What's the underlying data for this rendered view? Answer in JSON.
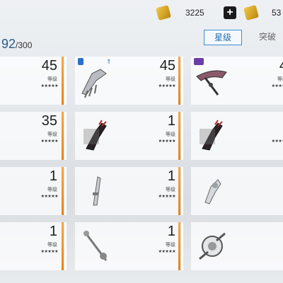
{
  "topbar": {
    "currency1_value": "3225",
    "currency2_value": "53",
    "plus_label": "+"
  },
  "inventory": {
    "count": "92",
    "capacity": "/300"
  },
  "tabs": {
    "active": "星级",
    "other": "突破"
  },
  "rows": [
    {
      "left_level": "45",
      "mid_level": "45",
      "right_level": "4"
    },
    {
      "left_level": "35",
      "mid_level": "1",
      "right_level": ""
    },
    {
      "left_level": "1",
      "mid_level": "1",
      "right_level": ""
    },
    {
      "left_level": "1",
      "mid_level": "1",
      "right_level": ""
    }
  ],
  "labels": {
    "level": "等级",
    "stars": "★★★★★"
  },
  "colors": {
    "accent_blue": "#3a8ed6",
    "orange_bar": "#e8831b",
    "badge_purple": "#6a3ea8"
  }
}
